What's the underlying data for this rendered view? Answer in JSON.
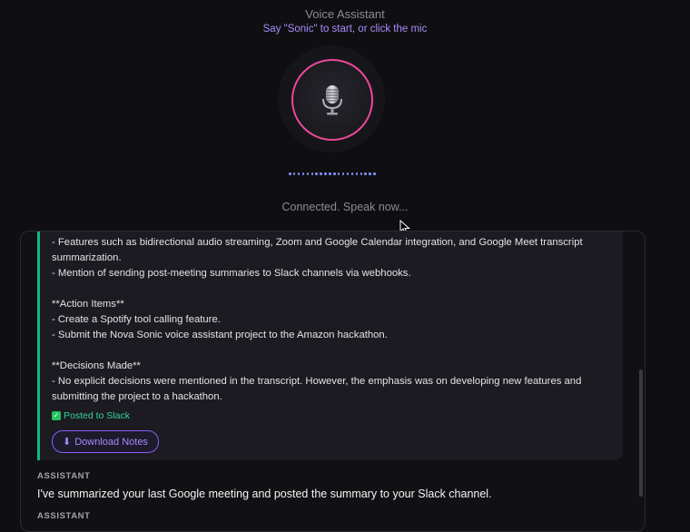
{
  "header": {
    "title": "Voice Assistant",
    "subtitle": "Say \"Sonic\" to start, or click the mic"
  },
  "mic": {
    "icon": "microphone-icon",
    "ring_color": "#ec4899"
  },
  "status": "Connected. Speak now...",
  "message": {
    "lines": [
      "- Features such as bidirectional audio streaming, Zoom and Google Calendar integration, and Google Meet transcript summarization.",
      "- Mention of sending post-meeting summaries to Slack channels via webhooks.",
      "",
      "**Action Items**",
      "- Create a Spotify tool calling feature.",
      "- Submit the Nova Sonic voice assistant project to the Amazon hackathon.",
      "",
      "**Decisions Made**",
      "- No explicit decisions were mentioned in the transcript. However, the emphasis was on developing new features and submitting the project to a hackathon."
    ],
    "posted_label": "Posted to Slack",
    "download_label": "Download Notes",
    "accent": "#10b981"
  },
  "assistant_messages": [
    {
      "role": "ASSISTANT",
      "text": "I've summarized your last Google meeting and posted the summary to your Slack channel."
    },
    {
      "role": "ASSISTANT",
      "text": ""
    }
  ]
}
